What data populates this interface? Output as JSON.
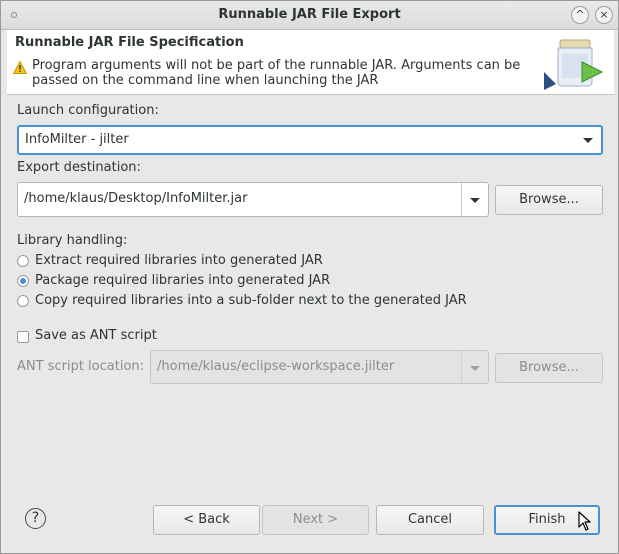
{
  "window": {
    "title": "Runnable JAR File Export",
    "minimize_glyph": "^",
    "close_glyph": "×"
  },
  "banner": {
    "heading": "Runnable JAR File Specification",
    "message": "Program arguments will not be part of the runnable JAR. Arguments can be passed on the command line when launching the JAR",
    "icon": "warning-icon"
  },
  "launch": {
    "label": "Launch configuration:",
    "value": "InfoMilter - jilter"
  },
  "export": {
    "label": "Export destination:",
    "value": "/home/klaus/Desktop/InfoMilter.jar",
    "browse_label": "Browse..."
  },
  "library": {
    "label": "Library handling:",
    "options": [
      {
        "label": "Extract required libraries into generated JAR",
        "checked": false
      },
      {
        "label": "Package required libraries into generated JAR",
        "checked": true
      },
      {
        "label": "Copy required libraries into a sub-folder next to the generated JAR",
        "checked": false
      }
    ]
  },
  "ant": {
    "checkbox_label": "Save as ANT script",
    "checked": false,
    "location_label": "ANT script location:",
    "location_value": "/home/klaus/eclipse-workspace.jilter",
    "browse_label": "Browse..."
  },
  "footer": {
    "help_glyph": "?",
    "back_label": "< Back",
    "next_label": "Next >",
    "cancel_label": "Cancel",
    "finish_label": "Finish"
  },
  "colors": {
    "accent": "#4a90d9",
    "warning": "#f5c211"
  }
}
